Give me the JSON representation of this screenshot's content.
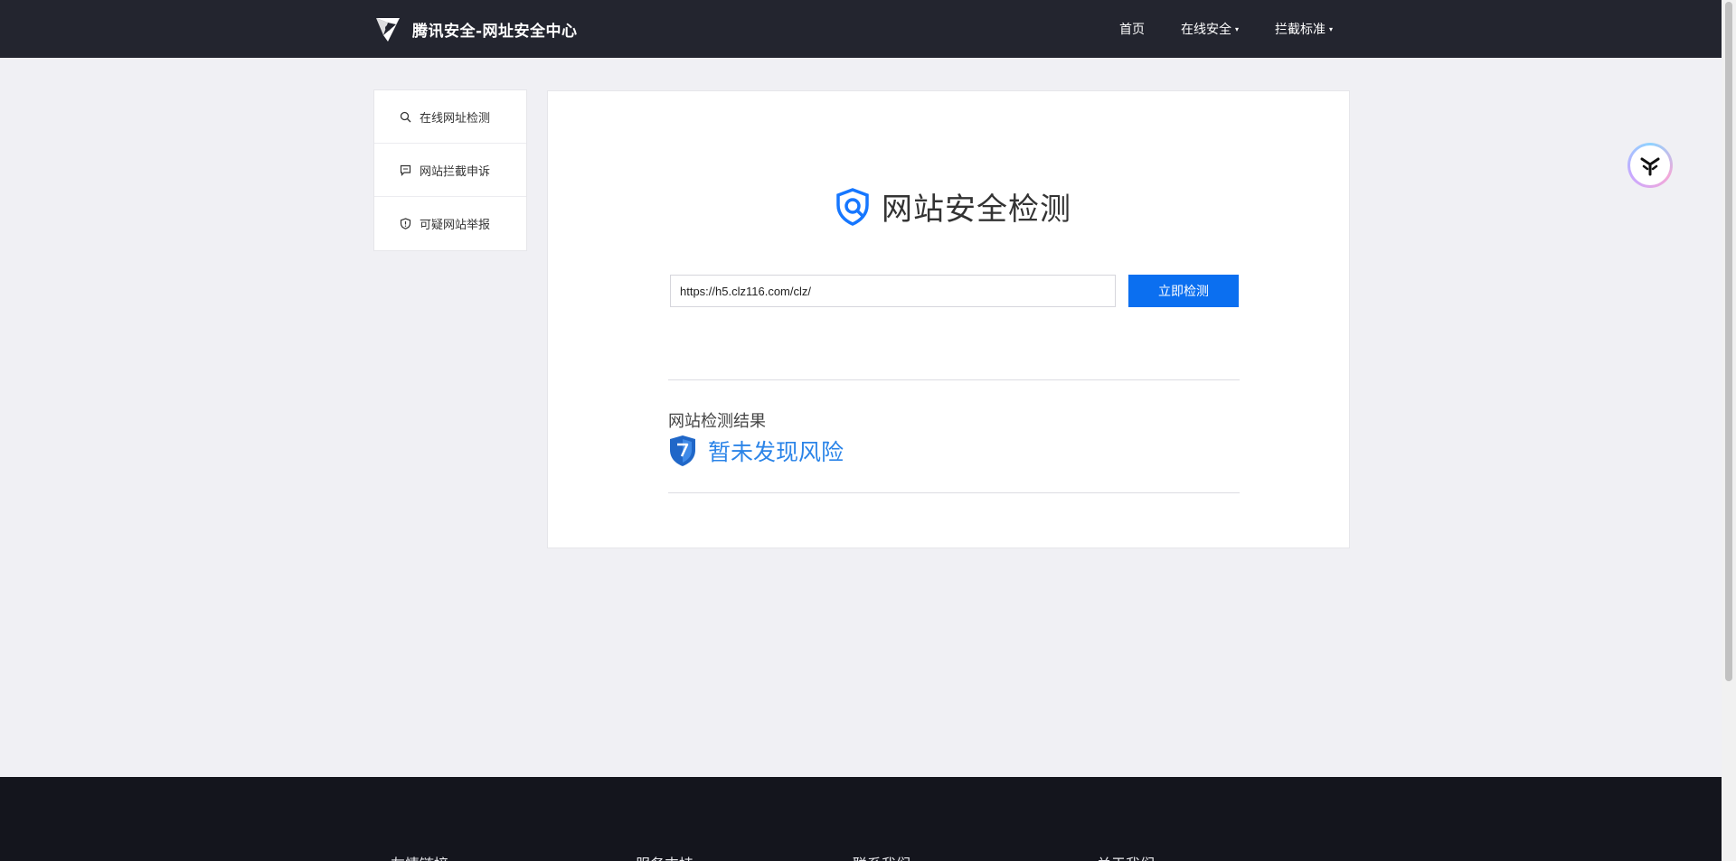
{
  "header": {
    "brand_title": "腾讯安全-网址安全中心",
    "nav": [
      {
        "label": "首页",
        "has_caret": false
      },
      {
        "label": "在线安全",
        "has_caret": true
      },
      {
        "label": "拦截标准",
        "has_caret": true
      }
    ],
    "caret": "▾"
  },
  "sidebar": {
    "items": [
      {
        "label": "在线网址检测",
        "icon": "search-icon"
      },
      {
        "label": "网站拦截申诉",
        "icon": "comment-icon"
      },
      {
        "label": "可疑网站举报",
        "icon": "shield-alert-icon"
      }
    ]
  },
  "main": {
    "title": "网站安全检测",
    "url_value": "https://h5.clz116.com/clz/",
    "check_button": "立即检测",
    "result_label": "网站检测结果",
    "result_text": "暂未发现风险"
  },
  "footer": {
    "columns": [
      "友情链接",
      "服务支持",
      "联系我们",
      "关于我们"
    ]
  },
  "colors": {
    "header_bg": "#23252f",
    "accent": "#0b6ff0",
    "result_text": "#2b84e8",
    "page_bg": "#f0f0f4",
    "footer_bg": "#14151d"
  }
}
